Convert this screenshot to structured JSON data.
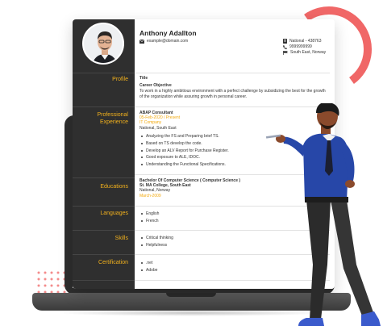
{
  "profile": {
    "name": "Anthony Adallton",
    "email": "example@domain.com",
    "nationality": "National - 438763",
    "phone": "9999999999",
    "location": "South East, Norway"
  },
  "sections": {
    "profile": "Profile",
    "experience": "Professional Experience",
    "education": "Educations",
    "languages": "Languages",
    "skills": "Skills",
    "certification": "Certification"
  },
  "summary": {
    "title": "Title",
    "objective_label": "Career Objective",
    "objective_text": "To work in a highly ambitious environment with a perfect challenge by subsidizing the best for the growth of the organization while assuring growth in personal career."
  },
  "experience": {
    "role": "ABAP Consultant",
    "dates": "05-Feb-2020 / Present",
    "company": "IT Company",
    "place": "National, South East",
    "bullets": [
      "Analyzing the FS and Preparing brief TS.",
      "Based on TS develop the code.",
      "Develop an ALV Report for Purchase Register.",
      "Good exposure to ALE, IDOC.",
      "Understanding the Functional Specifications."
    ]
  },
  "education": {
    "degree": "Bachelor Of Computer Science ( Computer Science )",
    "school": "St. MA College, South East",
    "place": "National, Norway",
    "date": "March-2009"
  },
  "languages": [
    "English",
    "French"
  ],
  "skills": [
    "Critical thinking",
    "Helpfulness"
  ],
  "certifications": [
    ".net",
    "Adobe"
  ],
  "colors": {
    "sidebar": "#2f2f2f",
    "accent": "#f2b11d",
    "ring": "#f06767",
    "dots": "#f48b8b"
  },
  "icons": [
    "envelope-icon",
    "id-card-icon",
    "phone-icon",
    "flag-icon"
  ]
}
